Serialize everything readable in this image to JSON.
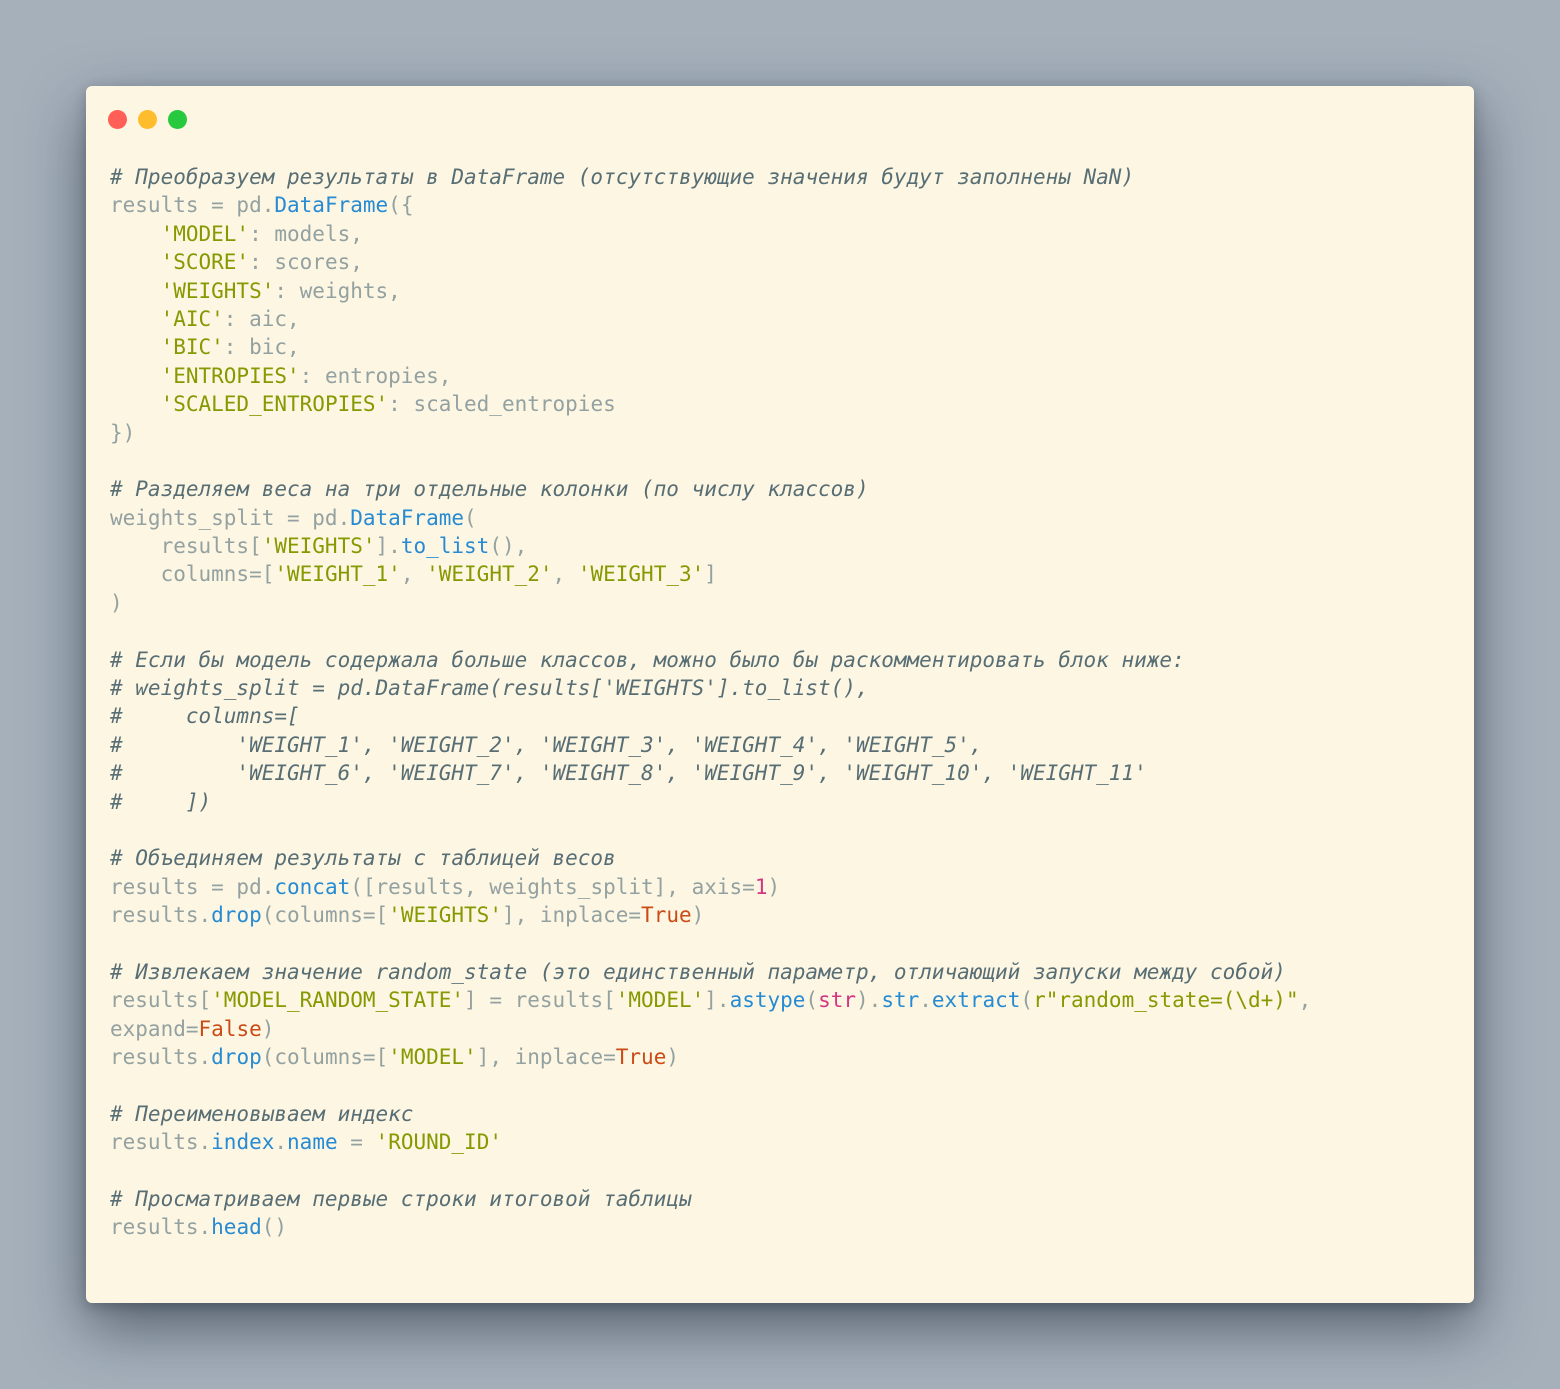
{
  "window": {
    "controls": [
      {
        "name": "close",
        "color": "#ff5f56"
      },
      {
        "name": "minimize",
        "color": "#ffbd2e"
      },
      {
        "name": "maximize",
        "color": "#27c93f"
      }
    ]
  },
  "syntax_colors": {
    "background": "#fdf6e3",
    "plain": "#93a1a1",
    "comment": "#586e75",
    "string": "#859900",
    "function": "#268bd2",
    "number": "#d33682",
    "keyword": "#cb4b16"
  },
  "code": {
    "lines": [
      [
        [
          "c",
          "# Преобразуем результаты в DataFrame (отсутствующие значения будут заполнены NaN)"
        ]
      ],
      [
        [
          "p",
          "results = pd."
        ],
        [
          "f",
          "DataFrame"
        ],
        [
          "p",
          "({"
        ]
      ],
      [
        [
          "p",
          "    "
        ],
        [
          "s",
          "'MODEL'"
        ],
        [
          "p",
          ": models,"
        ]
      ],
      [
        [
          "p",
          "    "
        ],
        [
          "s",
          "'SCORE'"
        ],
        [
          "p",
          ": scores,"
        ]
      ],
      [
        [
          "p",
          "    "
        ],
        [
          "s",
          "'WEIGHTS'"
        ],
        [
          "p",
          ": weights,"
        ]
      ],
      [
        [
          "p",
          "    "
        ],
        [
          "s",
          "'AIC'"
        ],
        [
          "p",
          ": aic,"
        ]
      ],
      [
        [
          "p",
          "    "
        ],
        [
          "s",
          "'BIC'"
        ],
        [
          "p",
          ": bic,"
        ]
      ],
      [
        [
          "p",
          "    "
        ],
        [
          "s",
          "'ENTROPIES'"
        ],
        [
          "p",
          ": entropies,"
        ]
      ],
      [
        [
          "p",
          "    "
        ],
        [
          "s",
          "'SCALED_ENTROPIES'"
        ],
        [
          "p",
          ": scaled_entropies"
        ]
      ],
      [
        [
          "p",
          "})"
        ]
      ],
      [],
      [
        [
          "c",
          "# Разделяем веса на три отдельные колонки (по числу классов)"
        ]
      ],
      [
        [
          "p",
          "weights_split = pd."
        ],
        [
          "f",
          "DataFrame"
        ],
        [
          "p",
          "("
        ]
      ],
      [
        [
          "p",
          "    results["
        ],
        [
          "s",
          "'WEIGHTS'"
        ],
        [
          "p",
          "]."
        ],
        [
          "f",
          "to_list"
        ],
        [
          "p",
          "(),"
        ]
      ],
      [
        [
          "p",
          "    columns=["
        ],
        [
          "s",
          "'WEIGHT_1'"
        ],
        [
          "p",
          ", "
        ],
        [
          "s",
          "'WEIGHT_2'"
        ],
        [
          "p",
          ", "
        ],
        [
          "s",
          "'WEIGHT_3'"
        ],
        [
          "p",
          "]"
        ]
      ],
      [
        [
          "p",
          ")"
        ]
      ],
      [],
      [
        [
          "c",
          "# Если бы модель содержала больше классов, можно было бы раскомментировать блок ниже:"
        ]
      ],
      [
        [
          "c",
          "# weights_split = pd.DataFrame(results['WEIGHTS'].to_list(),"
        ]
      ],
      [
        [
          "c",
          "#     columns=["
        ]
      ],
      [
        [
          "c",
          "#         'WEIGHT_1', 'WEIGHT_2', 'WEIGHT_3', 'WEIGHT_4', 'WEIGHT_5',"
        ]
      ],
      [
        [
          "c",
          "#         'WEIGHT_6', 'WEIGHT_7', 'WEIGHT_8', 'WEIGHT_9', 'WEIGHT_10', 'WEIGHT_11'"
        ]
      ],
      [
        [
          "c",
          "#     ])"
        ]
      ],
      [],
      [
        [
          "c",
          "# Объединяем результаты с таблицей весов"
        ]
      ],
      [
        [
          "p",
          "results = pd."
        ],
        [
          "f",
          "concat"
        ],
        [
          "p",
          "([results, weights_split], axis="
        ],
        [
          "n",
          "1"
        ],
        [
          "p",
          ")"
        ]
      ],
      [
        [
          "p",
          "results."
        ],
        [
          "f",
          "drop"
        ],
        [
          "p",
          "(columns=["
        ],
        [
          "s",
          "'WEIGHTS'"
        ],
        [
          "p",
          "], inplace="
        ],
        [
          "k",
          "True"
        ],
        [
          "p",
          ")"
        ]
      ],
      [],
      [
        [
          "c",
          "# Извлекаем значение random_state (это единственный параметр, отличающий запуски между собой)"
        ]
      ],
      [
        [
          "p",
          "results["
        ],
        [
          "s",
          "'MODEL_RANDOM_STATE'"
        ],
        [
          "p",
          "] = results["
        ],
        [
          "s",
          "'MODEL'"
        ],
        [
          "p",
          "]."
        ],
        [
          "f",
          "astype"
        ],
        [
          "p",
          "("
        ],
        [
          "n",
          "str"
        ],
        [
          "p",
          ")."
        ],
        [
          "f",
          "str"
        ],
        [
          "p",
          "."
        ],
        [
          "f",
          "extract"
        ],
        [
          "p",
          "("
        ],
        [
          "s",
          "r\"random_state=(\\d+)\""
        ],
        [
          "p",
          ","
        ]
      ],
      [
        [
          "p",
          "expand="
        ],
        [
          "k",
          "False"
        ],
        [
          "p",
          ")"
        ]
      ],
      [
        [
          "p",
          "results."
        ],
        [
          "f",
          "drop"
        ],
        [
          "p",
          "(columns=["
        ],
        [
          "s",
          "'MODEL'"
        ],
        [
          "p",
          "], inplace="
        ],
        [
          "k",
          "True"
        ],
        [
          "p",
          ")"
        ]
      ],
      [],
      [
        [
          "c",
          "# Переименовываем индекс"
        ]
      ],
      [
        [
          "p",
          "results."
        ],
        [
          "f",
          "index"
        ],
        [
          "p",
          "."
        ],
        [
          "f",
          "name"
        ],
        [
          "p",
          " = "
        ],
        [
          "s",
          "'ROUND_ID'"
        ]
      ],
      [],
      [
        [
          "c",
          "# Просматриваем первые строки итоговой таблицы"
        ]
      ],
      [
        [
          "p",
          "results."
        ],
        [
          "f",
          "head"
        ],
        [
          "p",
          "()"
        ]
      ]
    ]
  }
}
